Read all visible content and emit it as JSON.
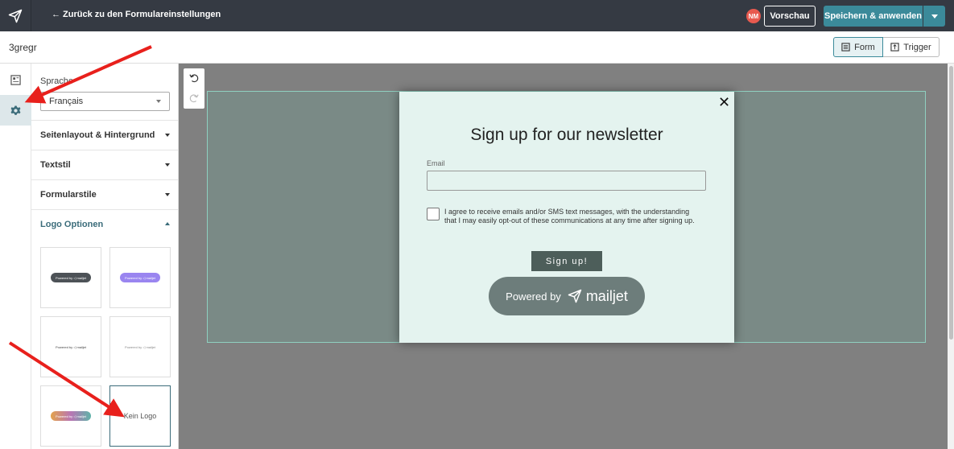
{
  "topbar": {
    "back_label": "← Zurück zu den Formulareinstellungen",
    "avatar_initials": "NM",
    "preview_label": "Vorschau",
    "save_label": "Speichern & anwenden"
  },
  "subbar": {
    "form_name": "3gregr",
    "tab_form": "Form",
    "tab_trigger": "Trigger"
  },
  "panel": {
    "language_label": "Sprache",
    "language_value": "Français",
    "sections": [
      {
        "label": "Seitenlayout & Hintergrund"
      },
      {
        "label": "Textstil"
      },
      {
        "label": "Formularstile"
      },
      {
        "label": "Logo Optionen"
      }
    ],
    "logo_options": {
      "powered_text": "Powered by",
      "brand_text": "mailjet",
      "no_logo_label": "Kein Logo"
    }
  },
  "popup": {
    "title": "Sign up for our newsletter",
    "email_label": "Email",
    "consent_text": "I agree to receive emails and/or SMS text messages, with the understanding that I may easily opt-out of these communications at any time after signing up.",
    "signup_label": "Sign up!",
    "powered_by": "Powered by",
    "brand": "mailjet"
  },
  "colors": {
    "topbar": "#353a43",
    "accent": "#3b8a9a",
    "canvas": "#808080",
    "popup_bg": "#e4f3ef",
    "arrow": "#e8201c"
  }
}
